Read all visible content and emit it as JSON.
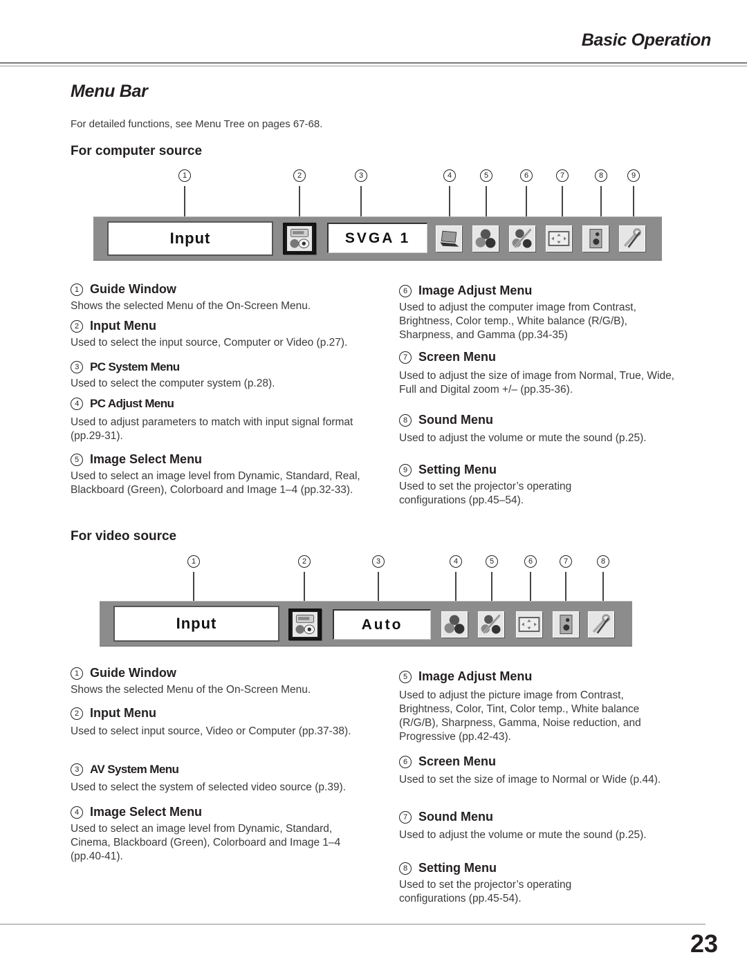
{
  "header": {
    "section": "Basic Operation",
    "title": "Menu Bar",
    "intro": "For detailed functions, see Menu Tree on pages 67-68."
  },
  "computer_source": {
    "heading": "For computer source",
    "bar": {
      "guide_text": "Input",
      "value_text": "SVGA 1",
      "icons": [
        "input-menu-icon",
        "pc-adjust-laptop-icon",
        "image-select-balls-icon",
        "image-adjust-balls-pencil-icon",
        "screen-arrows-icon",
        "sound-speaker-icon",
        "setting-wrench-screwdriver-icon"
      ]
    },
    "callouts": [
      "1",
      "2",
      "3",
      "4",
      "5",
      "6",
      "7",
      "8",
      "9"
    ],
    "items": [
      {
        "num": "1",
        "title": "Guide Window",
        "text": "Shows the selected Menu of the On-Screen Menu."
      },
      {
        "num": "2",
        "title": "Input Menu",
        "text": "Used to select the input source, Computer or Video (p.27)."
      },
      {
        "num": "3",
        "title": "PC System Menu",
        "text": "Used to select the computer system (p.28)."
      },
      {
        "num": "4",
        "title": "PC Adjust Menu",
        "text": "Used to adjust parameters to match with input signal format (pp.29-31)."
      },
      {
        "num": "5",
        "title": "Image Select Menu",
        "text": "Used to select an image level from Dynamic, Standard, Real, Blackboard (Green), Colorboard and Image 1–4 (pp.32-33)."
      },
      {
        "num": "6",
        "title": "Image Adjust Menu",
        "text": "Used to adjust the computer image from Contrast, Brightness, Color temp., White balance (R/G/B), Sharpness, and Gamma (pp.34-35)"
      },
      {
        "num": "7",
        "title": "Screen Menu",
        "text": "Used to adjust the size of image from Normal, True, Wide, Full and Digital zoom +/– (pp.35-36)."
      },
      {
        "num": "8",
        "title": "Sound Menu",
        "text": "Used to adjust the volume or mute the sound (p.25)."
      },
      {
        "num": "9",
        "title": "Setting Menu",
        "text": "Used to set the projector’s operating configurations (pp.45–54)."
      }
    ]
  },
  "video_source": {
    "heading": "For video source",
    "bar": {
      "guide_text": "Input",
      "value_text": "Auto",
      "icons": [
        "input-menu-icon",
        "image-select-balls-icon",
        "image-adjust-balls-pencil-icon",
        "screen-arrows-icon",
        "sound-speaker-icon",
        "setting-wrench-screwdriver-icon"
      ]
    },
    "callouts": [
      "1",
      "2",
      "3",
      "4",
      "5",
      "6",
      "7",
      "8"
    ],
    "items": [
      {
        "num": "1",
        "title": "Guide Window",
        "text": "Shows the selected Menu of the On-Screen Menu."
      },
      {
        "num": "2",
        "title": "Input Menu",
        "text": "Used to select input source, Video or Computer (pp.37-38)."
      },
      {
        "num": "3",
        "title": "AV System Menu",
        "text": "Used to select the system of selected video source (p.39)."
      },
      {
        "num": "4",
        "title": "Image Select Menu",
        "text": "Used to select an image level from Dynamic, Standard, Cinema, Blackboard (Green), Colorboard and Image 1–4 (pp.40-41)."
      },
      {
        "num": "5",
        "title": "Image Adjust Menu",
        "text": "Used to adjust the picture image from Contrast, Brightness, Color, Tint, Color temp., White balance (R/G/B), Sharpness, Gamma, Noise reduction, and Progressive (pp.42-43)."
      },
      {
        "num": "6",
        "title": "Screen Menu",
        "text": "Used to set the size of image to Normal or Wide (p.44)."
      },
      {
        "num": "7",
        "title": "Sound Menu",
        "text": "Used to adjust the volume or mute the sound (p.25)."
      },
      {
        "num": "8",
        "title": "Setting Menu",
        "text": "Used to set the projector’s operating configurations (pp.45-54)."
      }
    ]
  },
  "footer": {
    "page_number": "23"
  }
}
